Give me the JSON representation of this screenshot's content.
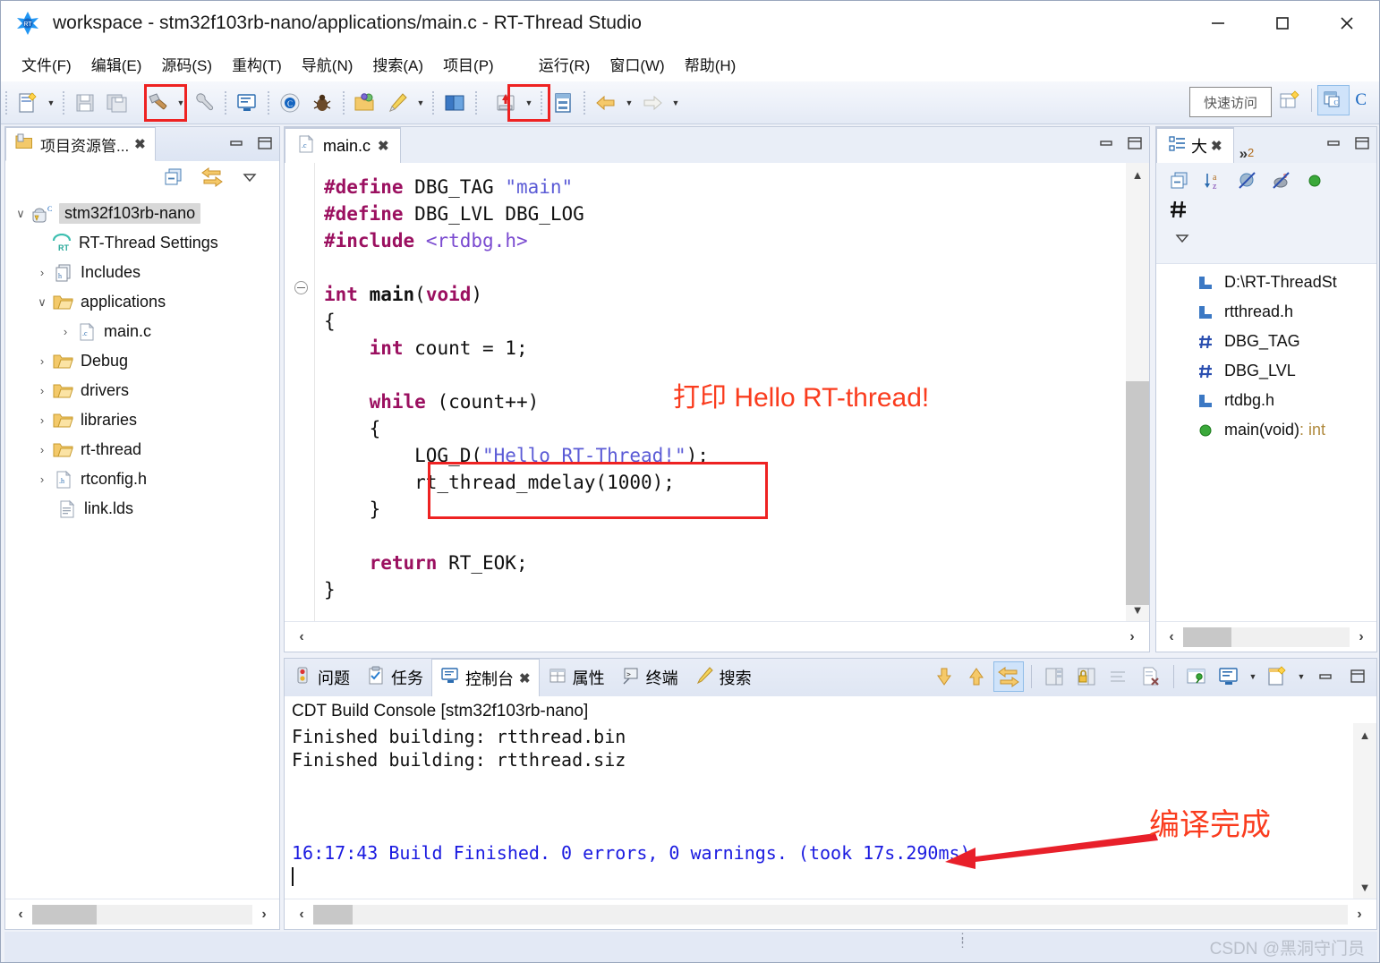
{
  "window": {
    "title": "workspace - stm32f103rb-nano/applications/main.c - RT-Thread Studio",
    "minimize_label": "—",
    "maximize_label": "☐",
    "close_label": "✕"
  },
  "menubar": {
    "items": [
      {
        "label": "文件(F)"
      },
      {
        "label": "编辑(E)"
      },
      {
        "label": "源码(S)"
      },
      {
        "label": "重构(T)"
      },
      {
        "label": "导航(N)"
      },
      {
        "label": "搜索(A)"
      },
      {
        "label": "项目(P)"
      },
      {
        "label": "运行(R)"
      },
      {
        "label": "窗口(W)"
      },
      {
        "label": "帮助(H)"
      }
    ]
  },
  "toolbar": {
    "quick_access": "快速访问",
    "perspective_c_label": "C",
    "icons": [
      "new-file-icon",
      "save-icon",
      "save-all-icon",
      "build-hammer-icon",
      "wrench-icon",
      "console-icon",
      "settings-gear-icon",
      "debug-bug-icon",
      "open-resource-icon",
      "pencil-icon",
      "book-icon",
      "download-flash-icon",
      "register-icon",
      "back-arrow-icon",
      "forward-arrow-icon"
    ]
  },
  "explorer": {
    "tab_label": "项目资源管...",
    "tab_close": "✖",
    "toolbar_icons": [
      "collapse-all-icon",
      "link-with-editor-icon",
      "view-menu-icon"
    ],
    "tree": [
      {
        "label": "stm32f103rb-nano",
        "indent": 0,
        "twist": "∨",
        "icon": "c-project-icon",
        "selected": true
      },
      {
        "label": "RT-Thread Settings",
        "indent": 1,
        "twist": "",
        "icon": "rt-settings-icon",
        "selected": false
      },
      {
        "label": "Includes",
        "indent": 1,
        "twist": "›",
        "icon": "includes-icon",
        "selected": false
      },
      {
        "label": "applications",
        "indent": 1,
        "twist": "∨",
        "icon": "folder-icon",
        "selected": false
      },
      {
        "label": "main.c",
        "indent": 2,
        "twist": "›",
        "icon": "c-file-icon",
        "selected": false
      },
      {
        "label": "Debug",
        "indent": 1,
        "twist": "›",
        "icon": "folder-icon",
        "selected": false
      },
      {
        "label": "drivers",
        "indent": 1,
        "twist": "›",
        "icon": "folder-icon",
        "selected": false
      },
      {
        "label": "libraries",
        "indent": 1,
        "twist": "›",
        "icon": "folder-icon",
        "selected": false
      },
      {
        "label": "rt-thread",
        "indent": 1,
        "twist": "›",
        "icon": "folder-icon",
        "selected": false
      },
      {
        "label": "rtconfig.h",
        "indent": 1,
        "twist": "›",
        "icon": "h-file-icon",
        "selected": false
      },
      {
        "label": "link.lds",
        "indent": 1,
        "twist": "",
        "icon": "lds-file-icon",
        "selected": false
      }
    ]
  },
  "editor": {
    "tab_label": "main.c",
    "tab_close": "✖",
    "minimize_label": "─",
    "maximize_label": "☐",
    "annotation": "打印 Hello RT-thread!",
    "code_lines": [
      "#define DBG_TAG \"main\"",
      "#define DBG_LVL DBG_LOG",
      "#include <rtdbg.h>",
      "",
      "int main(void)",
      "{",
      "    int count = 1;",
      "",
      "    while (count++)",
      "    {",
      "        LOG_D(\"Hello RT-Thread!\");",
      "        rt_thread_mdelay(1000);",
      "    }",
      "",
      "    return RT_EOK;",
      "}"
    ]
  },
  "outline": {
    "tab_label": "大",
    "tab_close": "✖",
    "overflow_label": "»",
    "overflow_count": "2",
    "toolbar_icons": [
      "collapse-all-icon",
      "sort-az-icon",
      "hide-fields-icon",
      "hide-static-icon",
      "hide-nonpublic-icon",
      "hide-macros-icon",
      "view-menu-icon"
    ],
    "items": [
      {
        "label": "D:\\RT-ThreadSt",
        "icon": "include-icon",
        "type": ""
      },
      {
        "label": "rtthread.h",
        "icon": "include-icon",
        "type": ""
      },
      {
        "label": "DBG_TAG",
        "icon": "macro-icon",
        "type": ""
      },
      {
        "label": "DBG_LVL",
        "icon": "macro-icon",
        "type": ""
      },
      {
        "label": "rtdbg.h",
        "icon": "include-icon",
        "type": ""
      },
      {
        "label": "main(void)",
        "icon": "function-icon",
        "type": " : int"
      }
    ]
  },
  "console": {
    "tabs": [
      {
        "label": "问题",
        "icon": "problems-icon",
        "active": false
      },
      {
        "label": "任务",
        "icon": "tasks-icon",
        "active": false
      },
      {
        "label": "控制台",
        "icon": "console-icon",
        "active": true
      },
      {
        "label": "属性",
        "icon": "properties-icon",
        "active": false
      },
      {
        "label": "终端",
        "icon": "terminal-icon",
        "active": false
      },
      {
        "label": "搜索",
        "icon": "search-icon",
        "active": false
      }
    ],
    "tab_close": "✖",
    "title": "CDT Build Console [stm32f103rb-nano]",
    "lines": [
      {
        "text": "Finished building: rtthread.bin",
        "color": "black"
      },
      {
        "text": "Finished building: rtthread.siz",
        "color": "black"
      },
      {
        "text": "",
        "color": "black"
      },
      {
        "text": "",
        "color": "black"
      },
      {
        "text": "",
        "color": "black"
      },
      {
        "text": "16:17:43 Build Finished. 0 errors, 0 warnings. (took 17s.290ms)",
        "color": "blue"
      }
    ],
    "annotation": "编译完成",
    "tool_icons": [
      "scroll-down-icon",
      "scroll-up-icon",
      "scroll-lock-icon",
      "clear-console-icon",
      "pin-console-icon",
      "show-console-icon",
      "new-console-icon",
      "minimize-icon",
      "maximize-icon"
    ]
  },
  "statusbar": {
    "watermark": "CSDN @黑洞守门员"
  },
  "colors": {
    "annotation_red": "#fa3c1e",
    "highlight_box": "#ee2222",
    "console_blue": "#1a1ae0",
    "keyword_magenta": "#9b1060",
    "string_blue": "#5b5bd6",
    "include_purple": "#7a4ad0"
  }
}
